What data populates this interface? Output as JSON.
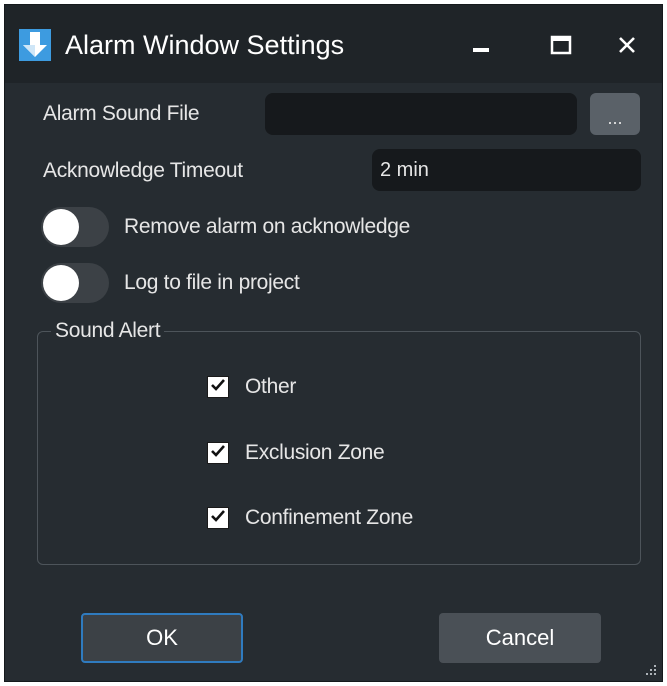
{
  "window": {
    "title": "Alarm Window Settings",
    "icons": {
      "app": "down-arrow-app-icon",
      "minimize": "minimize-icon",
      "maximize": "maximize-icon",
      "close": "close-icon"
    }
  },
  "form": {
    "sound_file_label": "Alarm Sound File",
    "sound_file_value": "",
    "browse_label": "...",
    "timeout_label": "Acknowledge Timeout",
    "timeout_value": "2 min"
  },
  "toggles": [
    {
      "label": "Remove alarm on acknowledge",
      "on": false
    },
    {
      "label": "Log to file in project",
      "on": false
    }
  ],
  "sound_alert": {
    "legend": "Sound Alert",
    "options": [
      {
        "label": "Other",
        "checked": true
      },
      {
        "label": "Exclusion Zone",
        "checked": true
      },
      {
        "label": "Confinement Zone",
        "checked": true
      }
    ]
  },
  "buttons": {
    "ok": "OK",
    "cancel": "Cancel"
  },
  "colors": {
    "window_bg": "#262c31",
    "titlebar_bg": "#1f2428",
    "field_bg": "#16191c",
    "accent": "#2f7bbf",
    "app_icon": "#3d9be0"
  }
}
